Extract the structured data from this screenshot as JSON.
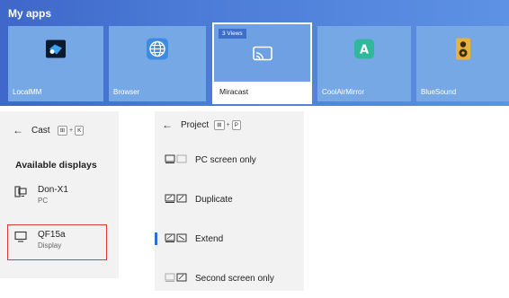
{
  "apps": {
    "title": "My apps",
    "tiles": [
      {
        "label": "LocalMM",
        "icon": "localmm-icon"
      },
      {
        "label": "Browser",
        "icon": "globe-icon"
      },
      {
        "label": "Miracast",
        "icon": "cast-screen-icon",
        "badge": "3 Views"
      },
      {
        "label": "CoolAirMirror",
        "icon": "coolair-icon"
      },
      {
        "label": "BlueSound",
        "icon": "speaker-icon"
      }
    ]
  },
  "cast": {
    "title": "Cast",
    "shortcut": [
      "⊞",
      "+",
      "K"
    ],
    "section_title": "Available displays",
    "devices": [
      {
        "name": "Don-X1",
        "type": "PC",
        "icon": "pc-icon"
      },
      {
        "name": "QF15a",
        "type": "Display",
        "icon": "monitor-icon"
      }
    ]
  },
  "project": {
    "title": "Project",
    "shortcut": [
      "⊞",
      "+",
      "P"
    ],
    "options": [
      {
        "label": "PC screen only",
        "icon": "pc-screen-only-icon"
      },
      {
        "label": "Duplicate",
        "icon": "duplicate-icon"
      },
      {
        "label": "Extend",
        "icon": "extend-icon",
        "selected": true
      },
      {
        "label": "Second screen only",
        "icon": "second-screen-icon"
      }
    ]
  },
  "colors": {
    "accent": "#2b6fd6",
    "highlight_box": "#d93a3a",
    "apps_bg": "#4a7ad6"
  }
}
